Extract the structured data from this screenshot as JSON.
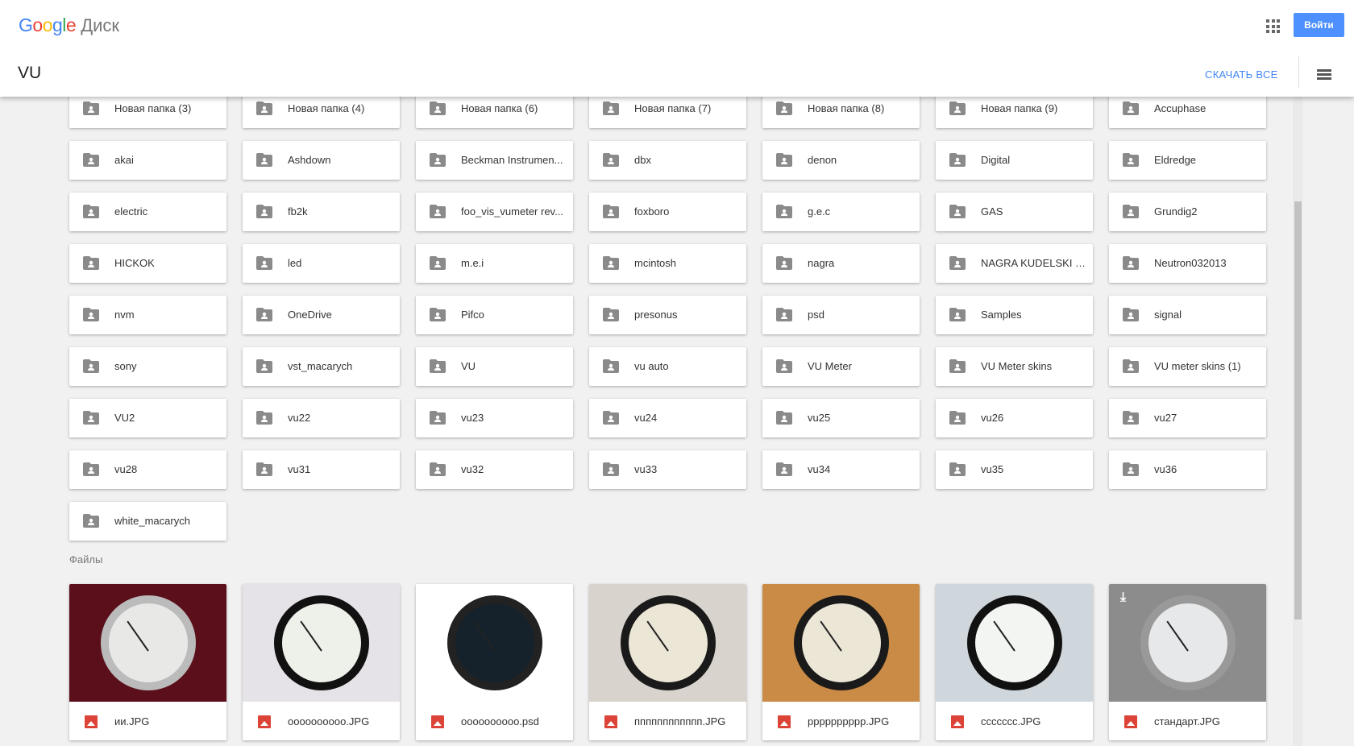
{
  "header": {
    "logo_google": "Google",
    "logo_product": "Диск",
    "login": "Войти",
    "download_all": "СКАЧАТЬ ВСЕ",
    "folder_title": "VU"
  },
  "folders": [
    "Новая папка (3)",
    "Новая папка (4)",
    "Новая папка (6)",
    "Новая папка (7)",
    "Новая папка (8)",
    "Новая папка (9)",
    "Accuphase",
    "akai",
    "Ashdown",
    "Beckman Instrumen...",
    "dbx",
    "denon",
    "Digital",
    "Eldredge",
    "electric",
    "fb2k",
    "foo_vis_vumeter rev...",
    "foxboro",
    "g.e.c",
    "GAS",
    "Grundig2",
    "HICKOK",
    "led",
    "m.e.i",
    "mcintosh",
    "nagra",
    "NAGRA KUDELSKI II...",
    "Neutron032013",
    "nvm",
    "OneDrive",
    "Pifco",
    "presonus",
    "psd",
    "Samples",
    "signal",
    "sony",
    "vst_macarych",
    "VU",
    "vu auto",
    "VU Meter",
    "VU Meter skins",
    "VU meter skins (1)",
    "VU2",
    "vu22",
    "vu23",
    "vu24",
    "vu25",
    "vu26",
    "vu27",
    "vu28",
    "vu31",
    "vu32",
    "vu33",
    "vu34",
    "vu35",
    "vu36",
    "white_macarych"
  ],
  "files_label": "Файлы",
  "files": [
    {
      "name": "ии.JPG",
      "bg": "#5a0f1a",
      "face": "#e8e8e6",
      "rim": "#bbb"
    },
    {
      "name": "oooooooooo.JPG",
      "bg": "#e6e3e8",
      "face": "#eef0ea",
      "rim": "#111"
    },
    {
      "name": "oooooooooo.psd",
      "bg": "#ffffff",
      "face": "#15222c",
      "rim": "#222"
    },
    {
      "name": "пппппппппппп.JPG",
      "bg": "#d8d3cc",
      "face": "#ece6d6",
      "rim": "#1a1a1a"
    },
    {
      "name": "pppppppppp.JPG",
      "bg": "#c98b45",
      "face": "#ece6d6",
      "rim": "#1a1a1a"
    },
    {
      "name": "ccccccc.JPG",
      "bg": "#cfd6dc",
      "face": "#f2f5f2",
      "rim": "#111"
    },
    {
      "name": "стандарт.JPG",
      "bg": "#8c8c8c",
      "face": "#e6e8ea",
      "rim": "#999"
    }
  ],
  "colors": {
    "accent": "#4285f4",
    "login_bg": "#4d90fe",
    "file_icon": "#db4437"
  }
}
